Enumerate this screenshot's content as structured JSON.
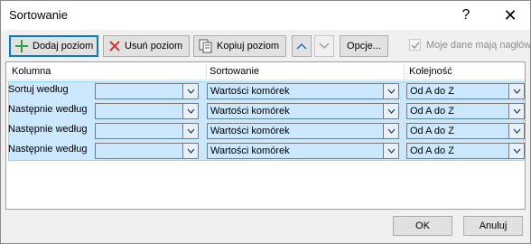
{
  "window": {
    "title": "Sortowanie",
    "help_glyph": "?",
    "close_glyph": "✕"
  },
  "toolbar": {
    "add_level_label": "Dodaj poziom",
    "delete_level_label": "Usuń poziom",
    "copy_level_label": "Kopiuj poziom",
    "options_label": "Opcje...",
    "headers_checkbox_label": "Moje dane mają nagłówki",
    "headers_checked": true
  },
  "grid": {
    "columns": [
      "Kolumna",
      "Sortowanie",
      "Kolejność"
    ],
    "rows": [
      {
        "label": "Sortuj według",
        "column_value": "",
        "sort_on": "Wartości komórek",
        "order": "Od A do Z"
      },
      {
        "label": "Następnie według",
        "column_value": "",
        "sort_on": "Wartości komórek",
        "order": "Od A do Z"
      },
      {
        "label": "Następnie według",
        "column_value": "",
        "sort_on": "Wartości komórek",
        "order": "Od A do Z"
      },
      {
        "label": "Następnie według",
        "column_value": "",
        "sort_on": "Wartości komórek",
        "order": "Od A do Z"
      }
    ]
  },
  "footer": {
    "ok_label": "OK",
    "cancel_label": "Anuluj"
  },
  "colors": {
    "selection": "#cce8ff",
    "accent": "#0078d7",
    "delete_icon": "#d13438",
    "add_icon": "#2ea043"
  }
}
